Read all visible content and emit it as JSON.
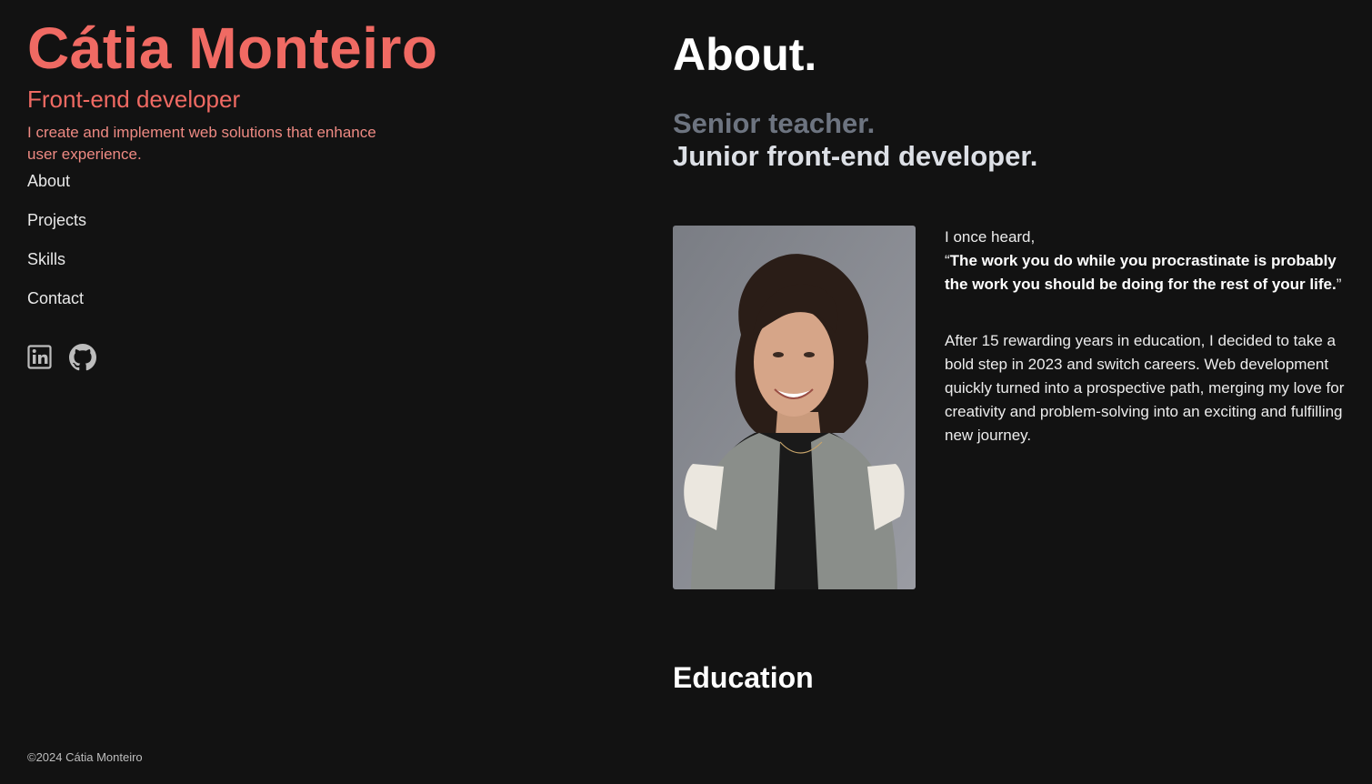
{
  "sidebar": {
    "name": "Cátia Monteiro",
    "role": "Front-end developer",
    "tagline": "I create and implement web solutions that enhance user experience.",
    "nav": [
      {
        "label": "About"
      },
      {
        "label": "Projects"
      },
      {
        "label": "Skills"
      },
      {
        "label": "Contact"
      }
    ],
    "socials": [
      {
        "icon": "linkedin-icon"
      },
      {
        "icon": "github-icon"
      }
    ]
  },
  "footer": {
    "copyright": "©2024 Cátia Monteiro"
  },
  "main": {
    "title": "About.",
    "subtitle_line1": "Senior teacher.",
    "subtitle_line2": "Junior front-end developer.",
    "bio": {
      "intro": "I once heard,",
      "quote_open": "“",
      "quote": "The work you do while you procrastinate is probably the work you should be doing for the rest of your life.",
      "quote_close": "”",
      "paragraph": "After 15 rewarding years in education, I decided to take a bold step in 2023 and switch careers. Web development quickly turned into a prospective path, merging my love for creativity and problem-solving into an exciting and fulfilling new journey."
    },
    "education_title": "Education"
  },
  "colors": {
    "background": "#121212",
    "accent": "#f06a63",
    "text": "#e6e6e6",
    "subtitle_dim": "#6d7480"
  }
}
